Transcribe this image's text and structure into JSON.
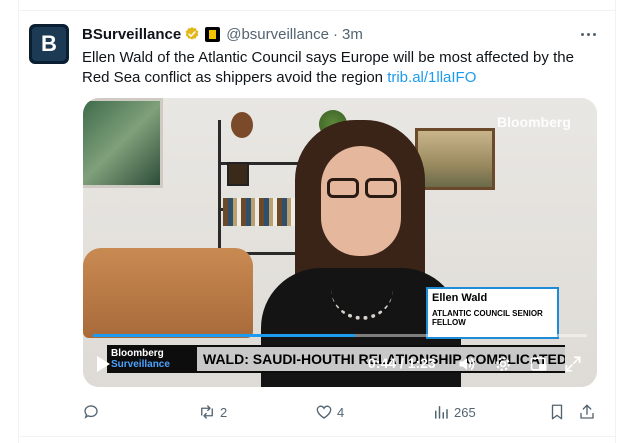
{
  "post": {
    "author_name": "BSurveillance",
    "author_handle": "@bsurveillance",
    "separator": "·",
    "time": "3m",
    "avatar_letter": "B",
    "text": "Ellen Wald of the Atlantic Council says Europe will be most affected by the Red Sea conflict as shippers avoid the region ",
    "link": "trib.al/1llaIFO"
  },
  "video": {
    "brand_watermark": "Bloomberg",
    "lower_third_name": "Ellen Wald",
    "lower_third_title": "ATLANTIC COUNCIL SENIOR FELLOW",
    "ticker_logo_top": "Bloomberg",
    "ticker_logo_bottom": "Surveillance",
    "ticker_text": "WALD: SAUDI-HOUTHI RELATIONSHIP COMPLICATED",
    "time_display": "0:44 / 1:23",
    "progress_fraction": 0.53
  },
  "actions": {
    "reply_count": "",
    "repost_count": "2",
    "like_count": "4",
    "views_count": "265"
  },
  "colors": {
    "accent": "#1d9bf0",
    "text_primary": "#0f1419",
    "text_secondary": "#536471"
  }
}
